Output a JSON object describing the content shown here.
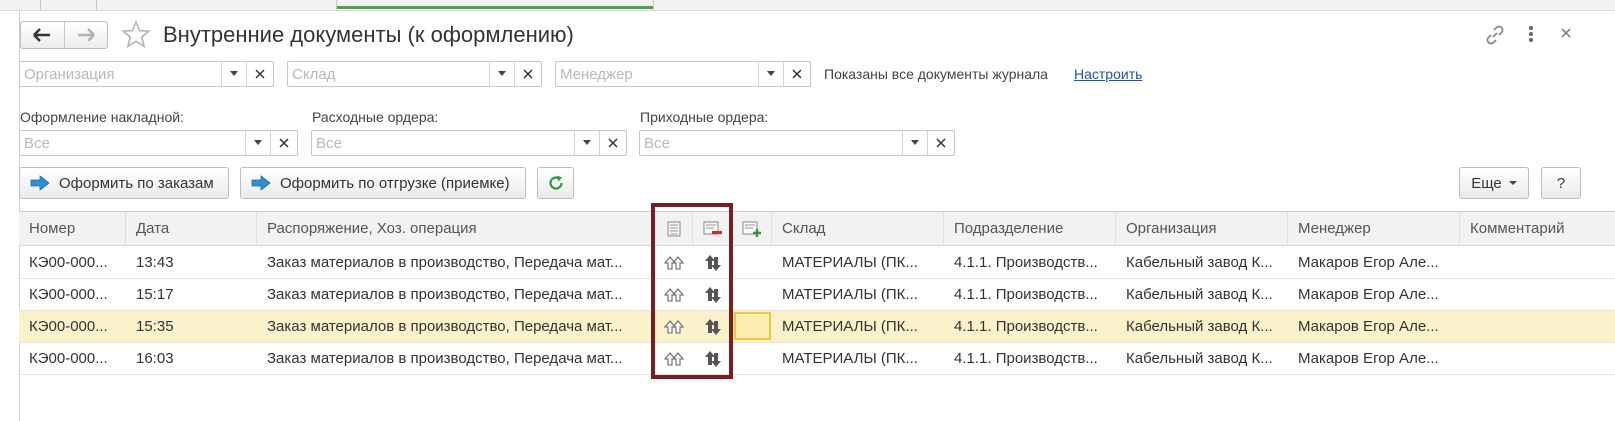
{
  "window": {
    "title": "Внутренние документы (к оформлению)"
  },
  "filters": {
    "organization_placeholder": "Организация",
    "warehouse_placeholder": "Склад",
    "manager_placeholder": "Менеджер",
    "journal_status": "Показаны все документы журнала",
    "configure_link": "Настроить",
    "invoice_label": "Оформление накладной:",
    "invoice_value": "Все",
    "expense_label": "Расходные ордера:",
    "expense_value": "Все",
    "income_label": "Приходные ордера:",
    "income_value": "Все"
  },
  "toolbar": {
    "by_orders": "Оформить по заказам",
    "by_shipment": "Оформить по отгрузке (приемке)",
    "more": "Еще",
    "help": "?"
  },
  "table": {
    "columns": [
      "Номер",
      "Дата",
      "Распоряжение, Хоз. операция",
      "Склад",
      "Подразделение",
      "Организация",
      "Менеджер",
      "Комментарий"
    ],
    "rows": [
      {
        "number": "КЭ00-000...",
        "date": "13:43",
        "order": "Заказ материалов в производство, Передача мат...",
        "warehouse": "МАТЕРИАЛЫ (ПК...",
        "division": "4.1.1. Производств...",
        "organization": "Кабельный завод К...",
        "manager": "Макаров Егор Але...",
        "comment": ""
      },
      {
        "number": "КЭ00-000...",
        "date": "15:17",
        "order": "Заказ материалов в производство, Передача мат...",
        "warehouse": "МАТЕРИАЛЫ (ПК...",
        "division": "4.1.1. Производств...",
        "organization": "Кабельный завод К...",
        "manager": "Макаров Егор Але...",
        "comment": ""
      },
      {
        "number": "КЭ00-000...",
        "date": "15:35",
        "order": "Заказ материалов в производство, Передача мат...",
        "warehouse": "МАТЕРИАЛЫ (ПК...",
        "division": "4.1.1. Производств...",
        "organization": "Кабельный завод К...",
        "manager": "Макаров Егор Але...",
        "comment": "",
        "selected": true
      },
      {
        "number": "КЭ00-000...",
        "date": "16:03",
        "order": "Заказ материалов в производство, Передача мат...",
        "warehouse": "МАТЕРИАЛЫ (ПК...",
        "division": "4.1.1. Производств...",
        "organization": "Кабельный завод К...",
        "manager": "Макаров Егор Але...",
        "comment": ""
      }
    ]
  },
  "icons": {
    "back": "arrow-left-icon",
    "forward": "arrow-right-icon",
    "favorite": "star-icon",
    "link": "link-icon",
    "menu": "kebab-menu-icon",
    "close": "close-icon",
    "dropdown": "chevron-down-icon",
    "clear": "clear-icon",
    "refresh": "refresh-icon",
    "expense_order": "double-up-arrow-icon",
    "income_order": "up-down-arrows-icon"
  },
  "colors": {
    "accent_link": "#1a55b0",
    "selected_row": "#fbf2cb",
    "selected_cell_border": "#f0c640",
    "highlight_frame": "#7a1d20",
    "refresh_green": "#2e9b3a",
    "arrow_blue": "#2f8fd6"
  }
}
